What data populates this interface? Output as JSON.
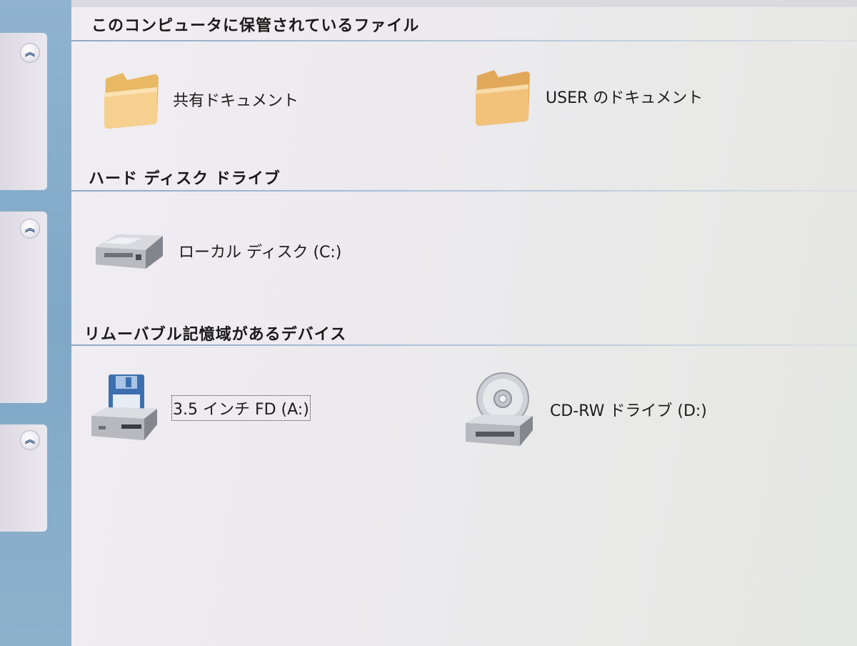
{
  "task_panes": [
    {
      "toggle_icon": "collapse-up-icon",
      "glyph": "︽"
    },
    {
      "toggle_icon": "collapse-up-icon",
      "glyph": "︽"
    },
    {
      "toggle_icon": "collapse-up-icon",
      "glyph": "︽"
    }
  ],
  "groups": {
    "stored_files": {
      "header": "このコンピュータに保管されているファイル",
      "items": [
        {
          "label": "共有ドキュメント",
          "icon": "folder-icon"
        },
        {
          "label": "USER のドキュメント",
          "icon": "folder-icon"
        }
      ]
    },
    "hard_disk": {
      "header": "ハード ディスク ドライブ",
      "items": [
        {
          "label": "ローカル ディスク (C:)",
          "icon": "hard-disk-icon"
        }
      ]
    },
    "removable": {
      "header": "リムーバブル記憶域があるデバイス",
      "items": [
        {
          "label": "3.5 インチ FD (A:)",
          "icon": "floppy-drive-icon",
          "selected": true
        },
        {
          "label": "CD-RW ドライブ (D:)",
          "icon": "cd-drive-icon"
        }
      ]
    }
  },
  "colors": {
    "taskpane": "#8fb3d0",
    "header_rule": "#8fa9c7",
    "folder": "#f2c77a"
  }
}
